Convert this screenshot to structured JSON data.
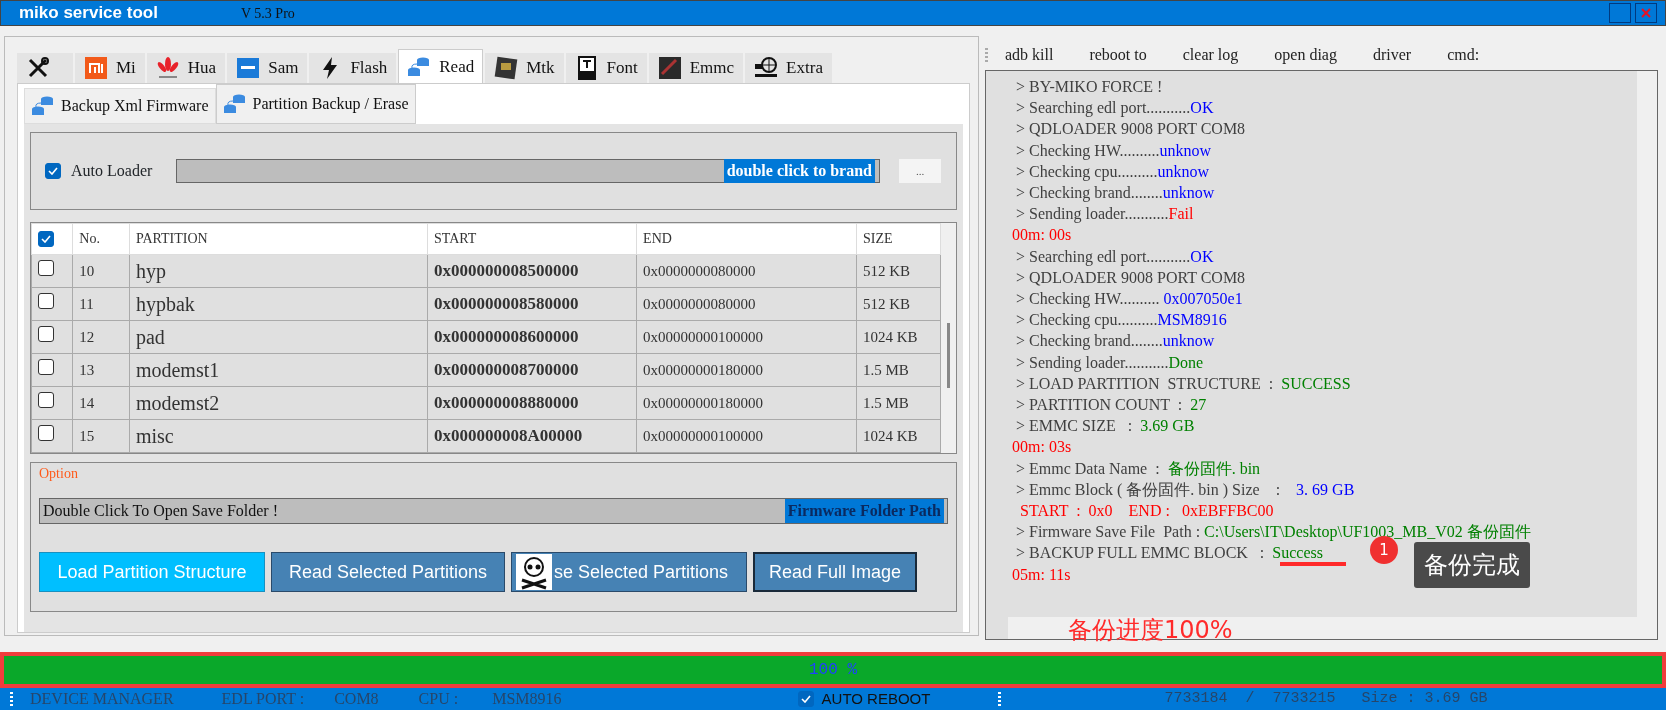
{
  "window": {
    "title": "miko service tool",
    "version": "V 5.3 Pro"
  },
  "tabs": [
    {
      "selected": false
    },
    {
      "label": "Mi",
      "selected": false
    },
    {
      "label": "Hua",
      "selected": false
    },
    {
      "label": "Sam",
      "selected": false
    },
    {
      "label": "Flash",
      "selected": false
    },
    {
      "label": "Read",
      "selected": true
    },
    {
      "label": "Mtk",
      "selected": false
    },
    {
      "label": "Font",
      "selected": false
    },
    {
      "label": "Emmc",
      "selected": false
    },
    {
      "label": "Extra",
      "selected": false
    }
  ],
  "sub_tabs": [
    {
      "label": "Backup Xml Firmware",
      "selected": false
    },
    {
      "label": "Partition Backup / Erase",
      "selected": true
    }
  ],
  "loader": {
    "label": "Auto Loader",
    "checked": true,
    "value": "double click to brand",
    "browse": "..."
  },
  "table": {
    "select_all": true,
    "columns": [
      "No.",
      "PARTITION",
      "START",
      "END",
      "SIZE"
    ],
    "rows": [
      {
        "checked": false,
        "no": "10",
        "name": "hyp",
        "start": "0x000000008500000",
        "end": "0x0000000080000",
        "size": "512 KB"
      },
      {
        "checked": false,
        "no": "11",
        "name": "hypbak",
        "start": "0x000000008580000",
        "end": "0x0000000080000",
        "size": "512 KB"
      },
      {
        "checked": false,
        "no": "12",
        "name": "pad",
        "start": "0x000000008600000",
        "end": "0x00000000100000",
        "size": "1024 KB"
      },
      {
        "checked": false,
        "no": "13",
        "name": "modemst1",
        "start": "0x000000008700000",
        "end": "0x00000000180000",
        "size": "1.5 MB"
      },
      {
        "checked": false,
        "no": "14",
        "name": "modemst2",
        "start": "0x000000008880000",
        "end": "0x00000000180000",
        "size": "1.5 MB"
      },
      {
        "checked": false,
        "no": "15",
        "name": "misc",
        "start": "0x000000008A00000",
        "end": "0x00000000100000",
        "size": "1024 KB"
      }
    ]
  },
  "option": {
    "title": "Option",
    "folder_hint": "Double Click To Open Save Folder !",
    "folder_label": "Firmware Folder Path"
  },
  "buttons": [
    {
      "label": "Load Partition Structure",
      "kind": "primary"
    },
    {
      "label": "Read Selected Partitions",
      "kind": "normal"
    },
    {
      "label": "se Selected Partitions",
      "kind": "skull"
    },
    {
      "label": "Read Full Image",
      "kind": "outlined"
    }
  ],
  "log_toolbar": [
    "adb kill",
    "reboot to",
    "clear log",
    "open diag",
    "driver",
    "cmd:"
  ],
  "log": [
    [
      {
        "text": " > BY-MIKO FORCE !",
        "color": "#404040"
      }
    ],
    [
      {
        "text": " > Searching edl port...........",
        "color": "#404040"
      },
      {
        "text": "OK",
        "color": "#0000ff"
      }
    ],
    [
      {
        "text": " > QDLOADER 9008 PORT COM8",
        "color": "#404040"
      }
    ],
    [
      {
        "text": " > Checking HW..........",
        "color": "#404040"
      },
      {
        "text": "unknow",
        "color": "#0000ff"
      }
    ],
    [
      {
        "text": " > Checking cpu..........",
        "color": "#404040"
      },
      {
        "text": "unknow",
        "color": "#0000ff"
      }
    ],
    [
      {
        "text": " > Checking brand........",
        "color": "#404040"
      },
      {
        "text": "unknow",
        "color": "#0000ff"
      }
    ],
    [
      {
        "text": " > Sending loader...........",
        "color": "#404040"
      },
      {
        "text": "Fail",
        "color": "#ff0000"
      }
    ],
    [
      {
        "text": "00m: 00s",
        "color": "#ff0000"
      }
    ],
    [
      {
        "text": " > Searching edl port...........",
        "color": "#404040"
      },
      {
        "text": "OK",
        "color": "#0000ff"
      }
    ],
    [
      {
        "text": " > QDLOADER 9008 PORT COM8",
        "color": "#404040"
      }
    ],
    [
      {
        "text": " > Checking HW.......... ",
        "color": "#404040"
      },
      {
        "text": "0x007050e1",
        "color": "#0000ff"
      }
    ],
    [
      {
        "text": " > Checking cpu..........",
        "color": "#404040"
      },
      {
        "text": "MSM8916",
        "color": "#0000ff"
      }
    ],
    [
      {
        "text": " > Checking brand........",
        "color": "#404040"
      },
      {
        "text": "unknow",
        "color": "#0000ff"
      }
    ],
    [
      {
        "text": " > Sending loader...........",
        "color": "#404040"
      },
      {
        "text": "Done",
        "color": "#008000"
      }
    ],
    [
      {
        "text": " > LOAD PARTITION  STRUCTURE  :  ",
        "color": "#404040"
      },
      {
        "text": "SUCCESS",
        "color": "#008000"
      }
    ],
    [
      {
        "text": " > PARTITION COUNT  :  ",
        "color": "#404040"
      },
      {
        "text": "27",
        "color": "#008000"
      }
    ],
    [
      {
        "text": " > EMMC SIZE   :  ",
        "color": "#404040"
      },
      {
        "text": "3.69 GB",
        "color": "#008000"
      }
    ],
    [
      {
        "text": "00m: 03s",
        "color": "#ff0000"
      }
    ],
    [
      {
        "text": " > Emmc Data Name  :  ",
        "color": "#404040"
      },
      {
        "text": "备份固件. bin",
        "color": "#008000"
      }
    ],
    [
      {
        "text": " > Emmc Block ( 备份固件. bin ) Size    :    ",
        "color": "#404040"
      },
      {
        "text": "3. 69 GB",
        "color": "#0000ff"
      }
    ],
    [
      {
        "text": "  START  :  0x0    END :   0xEBFFBC00",
        "color": "#ff0000"
      }
    ],
    [
      {
        "text": " > Firmware Save File  Path : ",
        "color": "#404040"
      },
      {
        "text": "C:\\Users\\IT\\Desktop\\UF1003_MB_V02 备份固件",
        "color": "#008000"
      }
    ],
    [
      {
        "text": " > BACKUP FULL EMMC BLOCK   :  ",
        "color": "#404040"
      },
      {
        "text": "Success",
        "color": "#008000"
      }
    ],
    [
      {
        "text": "05m: 11s",
        "color": "#ff0000"
      }
    ]
  ],
  "annotations": {
    "step": "1",
    "callout": "备份完成",
    "progress_note": "备份进度100%"
  },
  "progress": {
    "level": 1.0,
    "reading": "100 %"
  },
  "status_bar": {
    "device_manager": "DEVICE MANAGER",
    "edl_label": "EDL PORT :",
    "edl_port": "COM8",
    "cpu_label": "CPU :",
    "cpu": "MSM8916",
    "auto_reboot": {
      "label": "AUTO REBOOT",
      "checked": true
    },
    "done": "7733184",
    "sep": "/",
    "total": "7733215",
    "size": "Size : 3.69 GB"
  }
}
